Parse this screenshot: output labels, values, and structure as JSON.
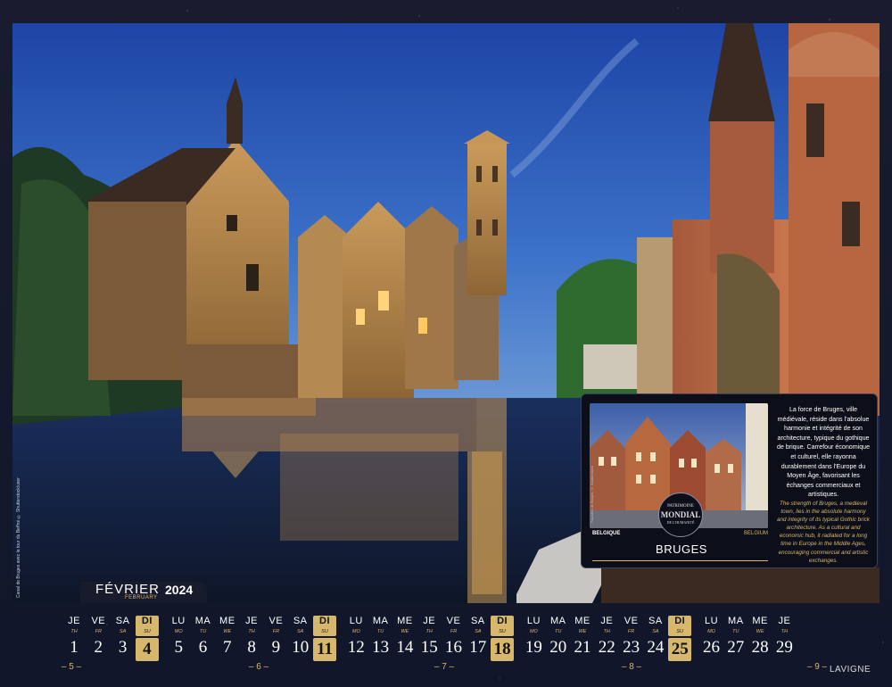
{
  "photo": {
    "credit": "Canal de Bruges avec la tour du Beffroi © Shutterstock/user"
  },
  "month": {
    "name": "FÉVRIER",
    "year": "2024",
    "english": "FEBRUARY"
  },
  "panel": {
    "inset_credit": "Façades de Bruges © Shutterstock",
    "unesco": [
      "PATRIMOINE",
      "MONDIAL",
      "DE L'HUMANITÉ"
    ],
    "country_fr": "BELGIQUE",
    "country_en": "BELGIUM",
    "city": "BRUGES",
    "desc_fr": "La force de Bruges, ville médiévale, réside dans l'absolue harmonie et intégrité de son architecture, typique du gothique de brique. Carrefour économique et culturel, elle rayonna durablement dans l'Europe du Moyen Âge, favorisant les échanges commerciaux et artistiques.",
    "desc_en": "The strength of Bruges, a medieval town, lies in the absolute harmony and integrity of its typical Gothic brick architecture. As a cultural and economic hub, it radiated for a long time in Europe in the Middle Ages, encouraging commercial and artistic exchanges."
  },
  "calendar": {
    "days": [
      {
        "fr": "JE",
        "en": "TH",
        "n": "1"
      },
      {
        "fr": "VE",
        "en": "FR",
        "n": "2"
      },
      {
        "fr": "SA",
        "en": "SA",
        "n": "3"
      },
      {
        "fr": "DI",
        "en": "SU",
        "n": "4",
        "sun": true
      },
      {
        "fr": "LU",
        "en": "MO",
        "n": "5"
      },
      {
        "fr": "MA",
        "en": "TU",
        "n": "6"
      },
      {
        "fr": "ME",
        "en": "WE",
        "n": "7"
      },
      {
        "fr": "JE",
        "en": "TH",
        "n": "8"
      },
      {
        "fr": "VE",
        "en": "FR",
        "n": "9"
      },
      {
        "fr": "SA",
        "en": "SA",
        "n": "10"
      },
      {
        "fr": "DI",
        "en": "SU",
        "n": "11",
        "sun": true
      },
      {
        "fr": "LU",
        "en": "MO",
        "n": "12"
      },
      {
        "fr": "MA",
        "en": "TU",
        "n": "13"
      },
      {
        "fr": "ME",
        "en": "WE",
        "n": "14"
      },
      {
        "fr": "JE",
        "en": "TH",
        "n": "15"
      },
      {
        "fr": "VE",
        "en": "FR",
        "n": "16"
      },
      {
        "fr": "SA",
        "en": "SA",
        "n": "17"
      },
      {
        "fr": "DI",
        "en": "SU",
        "n": "18",
        "sun": true
      },
      {
        "fr": "LU",
        "en": "MO",
        "n": "19"
      },
      {
        "fr": "MA",
        "en": "TU",
        "n": "20"
      },
      {
        "fr": "ME",
        "en": "WE",
        "n": "21"
      },
      {
        "fr": "JE",
        "en": "TH",
        "n": "22"
      },
      {
        "fr": "VE",
        "en": "FR",
        "n": "23"
      },
      {
        "fr": "SA",
        "en": "SA",
        "n": "24"
      },
      {
        "fr": "DI",
        "en": "SU",
        "n": "25",
        "sun": true
      },
      {
        "fr": "LU",
        "en": "MO",
        "n": "26"
      },
      {
        "fr": "MA",
        "en": "TU",
        "n": "27"
      },
      {
        "fr": "ME",
        "en": "WE",
        "n": "28"
      },
      {
        "fr": "JE",
        "en": "TH",
        "n": "29"
      }
    ],
    "weeks": [
      "– 5 –",
      "– 6 –",
      "– 7 –",
      "– 8 –",
      "– 9 –"
    ]
  },
  "brand": "LAVIGNE",
  "colors": {
    "background": "#15192a",
    "gold": "#d7b76b",
    "panel": "#0c0f1a"
  }
}
